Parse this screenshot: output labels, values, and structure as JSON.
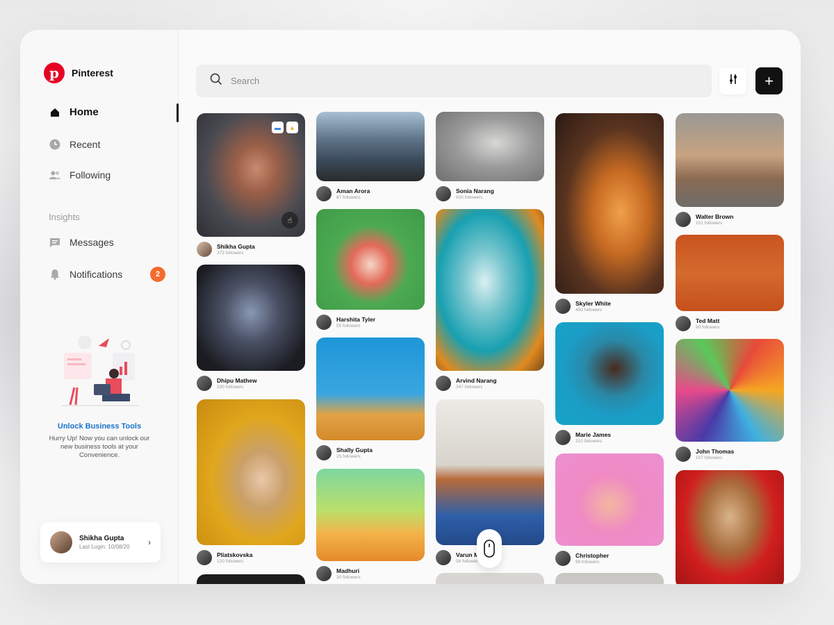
{
  "app": {
    "name": "Pinterest",
    "logo_letter": "p"
  },
  "sidebar": {
    "items": [
      {
        "label": "Home",
        "icon": "home-icon",
        "active": true
      },
      {
        "label": "Recent",
        "icon": "clock-icon"
      },
      {
        "label": "Following",
        "icon": "users-icon"
      }
    ],
    "section_label": "Insights",
    "insight_items": [
      {
        "label": "Messages",
        "icon": "message-icon"
      },
      {
        "label": "Notifications",
        "icon": "bell-icon",
        "badge": "2"
      }
    ],
    "promo": {
      "title": "Unlock Business Tools",
      "text": "Hurry Up! Now you can unlock our new business tools at your Convenience."
    },
    "user": {
      "name": "Shikha Gupta",
      "last_login": "Last Login: 10/08/20"
    }
  },
  "search": {
    "placeholder": "Search"
  },
  "colors": {
    "brand": "#e60023",
    "accent_badge": "#f46b2d",
    "promo_title": "#1a73c9"
  },
  "pins": [
    [
      {
        "name": "Shikha Gupta",
        "followers": "373 followers"
      },
      {
        "name": "Dhipu Mathew",
        "followers": "230 followers"
      },
      {
        "name": "Pliatskovska",
        "followers": "120 followers"
      }
    ],
    [
      {
        "name": "Aman Arora",
        "followers": "87 followers"
      },
      {
        "name": "Harshita Tyler",
        "followers": "55 followers"
      },
      {
        "name": "Shally Gupta",
        "followers": "25 followers"
      },
      {
        "name": "Madhuri",
        "followers": "30 followers"
      }
    ],
    [
      {
        "name": "Sonia Narang",
        "followers": "920 followers"
      },
      {
        "name": "Arvind Narang",
        "followers": "347 followers"
      },
      {
        "name": "Varun M",
        "followers": "58 followers"
      }
    ],
    [
      {
        "name": "Skyler White",
        "followers": "450 followers"
      },
      {
        "name": "Marie James",
        "followers": "310 followers"
      },
      {
        "name": "Christopher",
        "followers": "99 followers"
      }
    ],
    [
      {
        "name": "Walter Brown",
        "followers": "101 followers"
      },
      {
        "name": "Ted Matt",
        "followers": "90 followers"
      },
      {
        "name": "John Thomas",
        "followers": "107 followers"
      }
    ]
  ]
}
